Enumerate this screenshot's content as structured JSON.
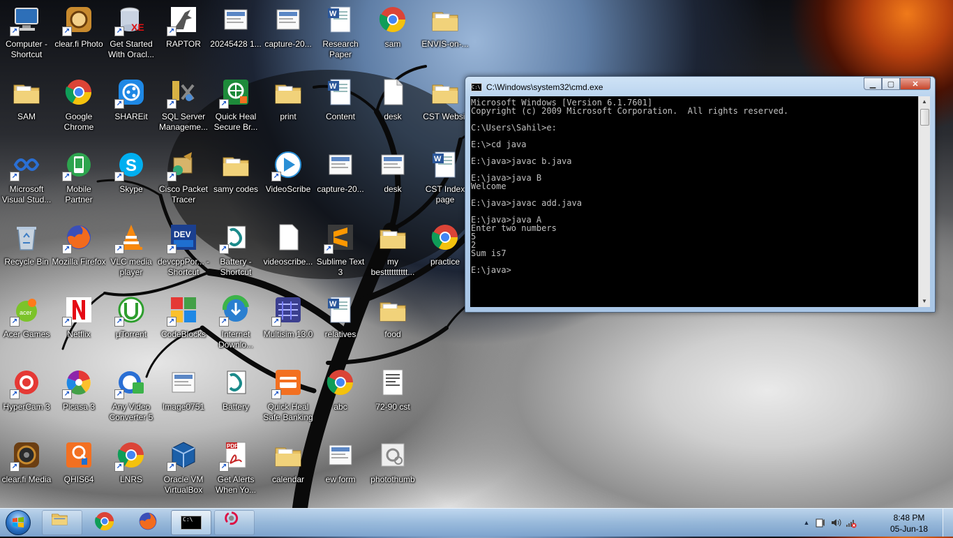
{
  "desktop": {
    "icons": [
      {
        "label": "Computer - Shortcut",
        "icon": "computer-icon",
        "shortcut": true
      },
      {
        "label": "clear.fi Photo",
        "icon": "photo-app-icon",
        "shortcut": true
      },
      {
        "label": "Get Started With Oracl...",
        "icon": "database-icon",
        "shortcut": true
      },
      {
        "label": "RAPTOR",
        "icon": "raptor-icon",
        "shortcut": true
      },
      {
        "label": "20245428 1...",
        "icon": "image-file-icon",
        "shortcut": false
      },
      {
        "label": "capture-20...",
        "icon": "image-file-icon",
        "shortcut": false
      },
      {
        "label": "Research Paper",
        "icon": "word-doc-icon",
        "shortcut": false
      },
      {
        "label": "sam",
        "icon": "chrome-icon",
        "shortcut": false
      },
      {
        "label": "ENVIS-on-...",
        "icon": "folder-icon",
        "shortcut": false
      },
      {
        "label": "SAM",
        "icon": "folder-icon",
        "shortcut": false
      },
      {
        "label": "Google Chrome",
        "icon": "chrome-icon",
        "shortcut": false
      },
      {
        "label": "SHAREit",
        "icon": "shareit-icon",
        "shortcut": true
      },
      {
        "label": "SQL Server Manageme...",
        "icon": "sql-server-icon",
        "shortcut": true
      },
      {
        "label": "Quick Heal Secure Br...",
        "icon": "quickheal-browser-icon",
        "shortcut": true
      },
      {
        "label": "print",
        "icon": "folder-icon",
        "shortcut": false
      },
      {
        "label": "Content",
        "icon": "word-doc-icon",
        "shortcut": false
      },
      {
        "label": "desk",
        "icon": "text-file-icon",
        "shortcut": false
      },
      {
        "label": "CST Websit",
        "icon": "folder-icon",
        "shortcut": false
      },
      {
        "label": "Microsoft Visual Stud...",
        "icon": "visual-studio-icon",
        "shortcut": true
      },
      {
        "label": "Mobile Partner",
        "icon": "mobile-partner-icon",
        "shortcut": true
      },
      {
        "label": "Skype",
        "icon": "skype-icon",
        "shortcut": true
      },
      {
        "label": "Cisco Packet Tracer",
        "icon": "packet-tracer-icon",
        "shortcut": true
      },
      {
        "label": "samy codes",
        "icon": "folder-icon",
        "shortcut": false
      },
      {
        "label": "VideoScribe",
        "icon": "videoscribe-icon",
        "shortcut": true
      },
      {
        "label": "capture-20...",
        "icon": "image-file-icon",
        "shortcut": false
      },
      {
        "label": "desk",
        "icon": "image-file-icon",
        "shortcut": false
      },
      {
        "label": "CST Index page",
        "icon": "word-doc-icon",
        "shortcut": false
      },
      {
        "label": "Recycle Bin",
        "icon": "recycle-bin-icon",
        "shortcut": false
      },
      {
        "label": "Mozilla Firefox",
        "icon": "firefox-icon",
        "shortcut": true
      },
      {
        "label": "VLC media player",
        "icon": "vlc-icon",
        "shortcut": true
      },
      {
        "label": "devcppPor... - Shortcut",
        "icon": "devcpp-icon",
        "shortcut": true
      },
      {
        "label": "Battery - Shortcut",
        "icon": "script-icon",
        "shortcut": true
      },
      {
        "label": "videoscribe...",
        "icon": "blank-file-icon",
        "shortcut": false
      },
      {
        "label": "Sublime Text 3",
        "icon": "sublime-icon",
        "shortcut": true
      },
      {
        "label": "my bestttttttttt...",
        "icon": "folder-icon",
        "shortcut": false
      },
      {
        "label": "practice",
        "icon": "chrome-icon",
        "shortcut": false
      },
      {
        "label": "Acer Games",
        "icon": "acer-games-icon",
        "shortcut": true
      },
      {
        "label": "Netflix",
        "icon": "netflix-icon",
        "shortcut": true
      },
      {
        "label": "µTorrent",
        "icon": "utorrent-icon",
        "shortcut": true
      },
      {
        "label": "CodeBlocks",
        "icon": "codeblocks-icon",
        "shortcut": true
      },
      {
        "label": "Internet Downlo...",
        "icon": "idm-icon",
        "shortcut": true
      },
      {
        "label": "Multisim 13.0",
        "icon": "multisim-icon",
        "shortcut": true
      },
      {
        "label": "relatives",
        "icon": "word-doc-icon",
        "shortcut": false
      },
      {
        "label": "food",
        "icon": "folder-icon",
        "shortcut": false
      },
      {
        "label": "HyperCam 3",
        "icon": "hypercam-icon",
        "shortcut": true
      },
      {
        "label": "Picasa 3",
        "icon": "picasa-icon",
        "shortcut": true
      },
      {
        "label": "Any Video Converter 5",
        "icon": "video-converter-icon",
        "shortcut": true
      },
      {
        "label": "Image0751",
        "icon": "image-file-icon",
        "shortcut": false
      },
      {
        "label": "Battery",
        "icon": "script-icon",
        "shortcut": false
      },
      {
        "label": "Quick Heal Safe Banking",
        "icon": "quickheal-banking-icon",
        "shortcut": true
      },
      {
        "label": "abc",
        "icon": "chrome-icon",
        "shortcut": false
      },
      {
        "label": "72-90 cst",
        "icon": "document-file-icon",
        "shortcut": false
      },
      {
        "label": "clear.fi Media",
        "icon": "speaker-app-icon",
        "shortcut": true
      },
      {
        "label": "QHIS64",
        "icon": "quickheal-icon",
        "shortcut": false
      },
      {
        "label": "LNRS",
        "icon": "chrome-icon",
        "shortcut": true
      },
      {
        "label": "Oracle VM VirtualBox",
        "icon": "virtualbox-icon",
        "shortcut": true
      },
      {
        "label": "Get Alerts When Yo...",
        "icon": "pdf-icon",
        "shortcut": true
      },
      {
        "label": "calendar",
        "icon": "folder-icon",
        "shortcut": false
      },
      {
        "label": "ew form",
        "icon": "image-file-icon",
        "shortcut": false
      },
      {
        "label": "photothumb",
        "icon": "image-settings-icon",
        "shortcut": false
      }
    ]
  },
  "cmd_window": {
    "title": "C:\\Windows\\system32\\cmd.exe",
    "icon_text": "C:\\",
    "minimize_glyph": "▁",
    "maximize_glyph": "▢",
    "close_glyph": "✕",
    "lines": [
      "Microsoft Windows [Version 6.1.7601]",
      "Copyright (c) 2009 Microsoft Corporation.  All rights reserved.",
      "",
      "C:\\Users\\Sahil>e:",
      "",
      "E:\\>cd java",
      "",
      "E:\\java>javac b.java",
      "",
      "E:\\java>java B",
      "Welcome",
      "",
      "E:\\java>javac add.java",
      "",
      "E:\\java>java A",
      "Enter two numbers",
      "5",
      "2",
      "Sum is7",
      "",
      "E:\\java>"
    ],
    "scroll_up_glyph": "▲",
    "scroll_down_glyph": "▼"
  },
  "taskbar": {
    "items": [
      {
        "name": "explorer",
        "icon": "explorer-folder-icon",
        "state": "pinned"
      },
      {
        "name": "chrome",
        "icon": "chrome-icon",
        "state": "normal"
      },
      {
        "name": "firefox",
        "icon": "firefox-icon",
        "state": "normal"
      },
      {
        "name": "cmd",
        "icon": "cmd-icon",
        "state": "active",
        "icon_text": "C:\\"
      },
      {
        "name": "snipping",
        "icon": "snipping-tool-icon",
        "state": "pinned"
      }
    ],
    "tray": {
      "show_hidden_glyph": "▲",
      "time": "8:48 PM",
      "date": "05-Jun-18"
    }
  }
}
